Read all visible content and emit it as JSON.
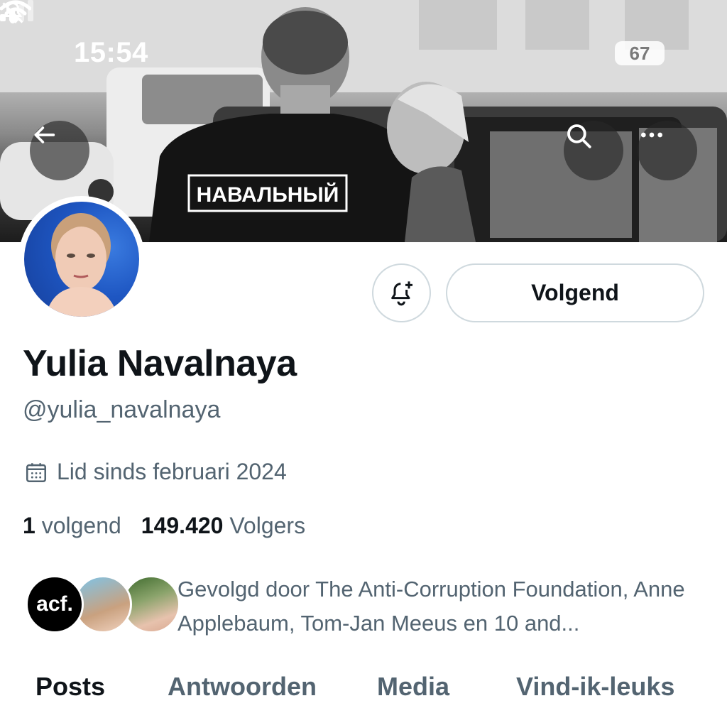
{
  "status_bar": {
    "time": "15:54",
    "battery": "67"
  },
  "banner": {
    "shirt_text": "НАВАЛЬНЫЙ"
  },
  "profile": {
    "display_name": "Yulia Navalnaya",
    "handle": "@yulia_navalnaya",
    "joined": "Lid sinds februari 2024",
    "following_count": "1",
    "following_label": "volgend",
    "followers_count": "149.420",
    "followers_label": "Volgers",
    "followed_by_text": "Gevolgd door The Anti-Corruption Foundation, Anne Applebaum, Tom-Jan Meeus en 10 and...",
    "acf_logo": "acf."
  },
  "actions": {
    "follow_label": "Volgend"
  },
  "tabs": [
    {
      "label": "Posts",
      "active": true
    },
    {
      "label": "Antwoorden",
      "active": false
    },
    {
      "label": "Media",
      "active": false
    },
    {
      "label": "Vind-ik-leuks",
      "active": false
    }
  ],
  "icons": {
    "back": "arrow-left-icon",
    "search": "search-icon",
    "more": "more-icon",
    "notify": "bell-plus-icon",
    "calendar": "calendar-icon",
    "silent": "bell-slash-icon"
  },
  "colors": {
    "text_primary": "#0f1419",
    "text_secondary": "#536471",
    "border": "#cfd9de"
  }
}
